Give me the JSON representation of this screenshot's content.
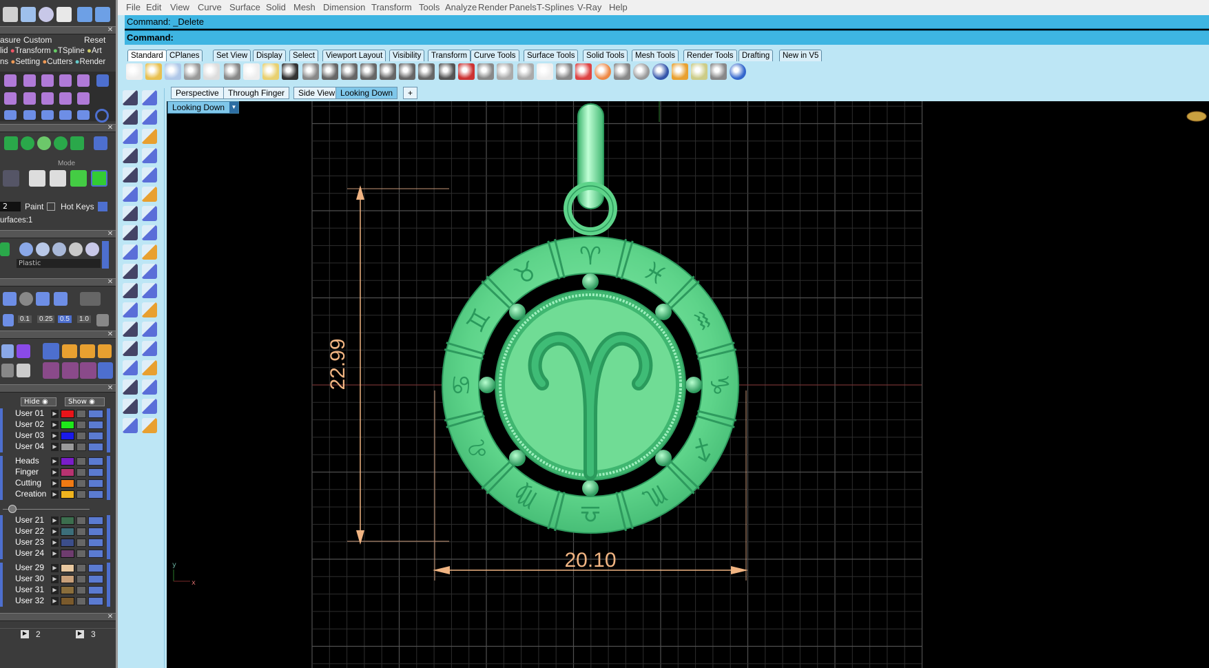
{
  "menu": {
    "items": [
      "File",
      "Edit",
      "View",
      "Curve",
      "Surface",
      "Solid",
      "Mesh",
      "Dimension",
      "Transform",
      "Tools",
      "Analyze",
      "Render",
      "Panels",
      "T-Splines",
      "V-Ray",
      "Help"
    ]
  },
  "command": {
    "history": "Command: _Delete",
    "prompt": "Command:"
  },
  "toolbar_tabs": [
    "Standard",
    "CPlanes",
    "Set View",
    "Display",
    "Select",
    "Viewport Layout",
    "Visibility",
    "Transform",
    "Curve Tools",
    "Surface Tools",
    "Solid Tools",
    "Mesh Tools",
    "Render Tools",
    "Drafting",
    "New in V5"
  ],
  "viewport_tabs": [
    "Perspective",
    "Through Finger",
    "Side View",
    "Looking Down"
  ],
  "viewport_add": "+",
  "viewport_title": "Looking Down",
  "left_panel": {
    "measure_label": "asure",
    "custom_label": "Custom",
    "reset_label": "Reset",
    "cat_row1": [
      "lid",
      "Transform",
      "TSpline",
      "Art"
    ],
    "cat_row2": [
      "ns",
      "Setting",
      "Cutters",
      "Render"
    ],
    "mode_label": "Mode",
    "paint_num": "2",
    "paint_label": "Paint",
    "hotkeys_label": "Hot Keys",
    "surfaces_label": "urfaces:1",
    "material_label": "Plastic",
    "steps": [
      "0.1",
      "0.25",
      "0.5",
      "1.0"
    ],
    "hide_label": "Hide",
    "show_label": "Show",
    "bottom_nums": [
      "2",
      "3"
    ]
  },
  "layers_group1": [
    {
      "name": "User 01",
      "color": "#e8141a"
    },
    {
      "name": "User 02",
      "color": "#1ee81a"
    },
    {
      "name": "User 03",
      "color": "#1a1ae8"
    },
    {
      "name": "User 04",
      "color": "#9a9a9a"
    }
  ],
  "layers_group2": [
    {
      "name": "Heads",
      "color": "#7a1ec8"
    },
    {
      "name": "Finger",
      "color": "#b83370"
    },
    {
      "name": "Cutting",
      "color": "#f07a14"
    },
    {
      "name": "Creation",
      "color": "#f0b41e"
    }
  ],
  "layers_group3": [
    {
      "name": "User 21",
      "color": "#3c6e4e"
    },
    {
      "name": "User 22",
      "color": "#3c6e7a"
    },
    {
      "name": "User 23",
      "color": "#3c4e8a"
    },
    {
      "name": "User 24",
      "color": "#6e3c6e"
    }
  ],
  "layers_group4": [
    {
      "name": "User 29",
      "color": "#e8c8a0"
    },
    {
      "name": "User 30",
      "color": "#c8a07a"
    },
    {
      "name": "User 31",
      "color": "#8a6e3c"
    },
    {
      "name": "User 32",
      "color": "#7a5a2c"
    }
  ],
  "dimensions": {
    "height": "22.99",
    "width": "20.10"
  },
  "axis": {
    "y": "y",
    "x": "x"
  },
  "colors": {
    "pendant": "#66d98c",
    "pendant_dark": "#2ea865",
    "dimension": "#f0b482",
    "command_bg": "#3eb5e2"
  },
  "zodiac_glyphs": [
    "♈",
    "♉",
    "♊",
    "♋",
    "♌",
    "♍",
    "♎",
    "♏",
    "♐",
    "♑",
    "♒",
    "♓"
  ]
}
